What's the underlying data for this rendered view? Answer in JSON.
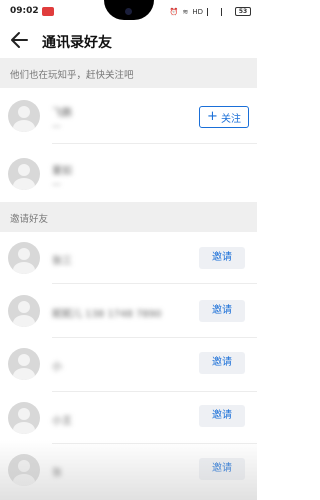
{
  "status_bar": {
    "time": "09:02",
    "net_label": "HD",
    "battery": "53"
  },
  "header": {
    "title": "通讯录好友"
  },
  "sections": {
    "playing": "他们也在玩知乎，赶快关注吧",
    "invite": "邀请好友"
  },
  "playing_users": [
    {
      "name": "飞鹏",
      "sub": "一",
      "button": "关注"
    },
    {
      "name": "董如",
      "sub": "一",
      "button": ""
    }
  ],
  "invite_users": [
    {
      "name": "张三",
      "button": "邀请"
    },
    {
      "name": "妮妮儿 138 1748 7890",
      "button": "邀请"
    },
    {
      "name": "小",
      "button": "邀请"
    },
    {
      "name": "小王",
      "button": "邀请"
    },
    {
      "name": "张",
      "button": "邀请"
    }
  ]
}
